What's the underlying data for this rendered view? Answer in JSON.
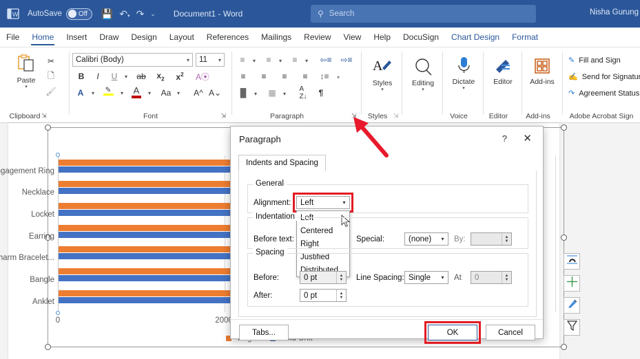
{
  "titlebar": {
    "app_icon": "word-logo-icon",
    "autosave_label": "AutoSave",
    "autosave_state": "Off",
    "save_icon": "save-icon",
    "undo_icon": "undo-icon",
    "redo_icon": "redo-icon",
    "more_icon": "more-commands-icon",
    "doc_title": "Document1  -  Word",
    "search_placeholder": "Search",
    "search_icon": "search-icon",
    "username": "Nisha Gurung"
  },
  "tabs": [
    {
      "label": "File",
      "active": false,
      "contextual": false
    },
    {
      "label": "Home",
      "active": true,
      "contextual": false
    },
    {
      "label": "Insert",
      "active": false,
      "contextual": false
    },
    {
      "label": "Draw",
      "active": false,
      "contextual": false
    },
    {
      "label": "Design",
      "active": false,
      "contextual": false
    },
    {
      "label": "Layout",
      "active": false,
      "contextual": false
    },
    {
      "label": "References",
      "active": false,
      "contextual": false
    },
    {
      "label": "Mailings",
      "active": false,
      "contextual": false
    },
    {
      "label": "Review",
      "active": false,
      "contextual": false
    },
    {
      "label": "View",
      "active": false,
      "contextual": false
    },
    {
      "label": "Help",
      "active": false,
      "contextual": false
    },
    {
      "label": "DocuSign",
      "active": false,
      "contextual": false
    },
    {
      "label": "Chart Design",
      "active": false,
      "contextual": true
    },
    {
      "label": "Format",
      "active": false,
      "contextual": true
    }
  ],
  "ribbon": {
    "clipboard": {
      "label": "Clipboard",
      "paste_label": "Paste",
      "paste_icon": "paste-icon",
      "cut_icon": "scissors-icon",
      "copy_icon": "copy-icon",
      "format_painter_icon": "format-painter-icon",
      "launcher_icon": "dialog-launcher-icon"
    },
    "font": {
      "label": "Font",
      "font_name": "Calibri (Body)",
      "font_size": "11",
      "bold_icon": "bold-icon",
      "italic_icon": "italic-icon",
      "underline_icon": "underline-icon",
      "strikethrough_icon": "strikethrough-icon",
      "subscript_icon": "subscript-icon",
      "superscript_icon": "superscript-icon",
      "clear_formatting_icon": "clear-formatting-icon",
      "text_effects_icon": "text-effects-icon",
      "highlight_icon": "text-highlight-icon",
      "font_color_icon": "font-color-icon",
      "change_case_icon": "change-case-icon",
      "grow_font_icon": "grow-font-icon",
      "shrink_font_icon": "shrink-font-icon",
      "launcher_icon": "dialog-launcher-icon"
    },
    "paragraph": {
      "label": "Paragraph",
      "bullets_icon": "bullets-icon",
      "numbering_icon": "numbering-icon",
      "multilevel_icon": "multilevel-list-icon",
      "decrease_indent_icon": "decrease-indent-icon",
      "increase_indent_icon": "increase-indent-icon",
      "align_left_icon": "align-left-icon",
      "align_center_icon": "align-center-icon",
      "align_right_icon": "align-right-icon",
      "justify_icon": "justify-icon",
      "line_spacing_icon": "line-spacing-icon",
      "shading_icon": "shading-icon",
      "borders_icon": "borders-icon",
      "sort_icon": "sort-icon",
      "show_marks_icon": "show-formatting-marks-icon",
      "launcher_icon": "dialog-launcher-icon"
    },
    "styles": {
      "label": "Styles",
      "button_label": "Styles",
      "icon": "styles-icon",
      "launcher_icon": "dialog-launcher-icon"
    },
    "editing": {
      "button_label": "Editing",
      "icon": "editing-search-icon"
    },
    "voice": {
      "label": "Voice",
      "button_label": "Dictate",
      "icon": "microphone-icon"
    },
    "editor": {
      "label": "Editor",
      "button_label": "Editor",
      "icon": "editor-pen-icon"
    },
    "addins": {
      "label": "Add-ins",
      "button_label": "Add-ins",
      "icon": "add-ins-grid-icon"
    },
    "adobe": {
      "label": "Adobe Acrobat Sign",
      "items": [
        {
          "label": "Fill and Sign",
          "icon": "fill-and-sign-icon"
        },
        {
          "label": "Send for Signature",
          "icon": "send-for-signature-icon"
        },
        {
          "label": "Agreement Status",
          "icon": "agreement-status-icon"
        }
      ]
    }
  },
  "chart_data": {
    "type": "bar",
    "orientation": "horizontal",
    "title": "",
    "categories": [
      "Ring Engagement Ring",
      "Necklace",
      "Locket",
      "Earring",
      "Charm Bracelet...",
      "Bangle",
      "Anklet"
    ],
    "series": [
      {
        "name": "Target",
        "color": "#ed7d31",
        "values": [
          2700,
          2620,
          2500,
          2680,
          2740,
          2700,
          2720
        ]
      },
      {
        "name": "Sold Unit",
        "color": "#4472c4",
        "values": [
          2660,
          2640,
          2700,
          2600,
          2730,
          2620,
          2680
        ]
      }
    ],
    "xlabel": "",
    "ylabel": "",
    "xticks": [
      "0",
      "2000"
    ],
    "xlim": [
      0,
      3000
    ],
    "grid": true,
    "legend_position": "bottom",
    "legend": [
      {
        "label": "Target",
        "color": "#ed7d31"
      },
      {
        "label": "Sold Unit",
        "color": "#4472c4"
      }
    ]
  },
  "chart_side_buttons": [
    {
      "name": "layout-options-icon",
      "title": "Layout Options"
    },
    {
      "name": "chart-elements-icon",
      "title": "Chart Elements"
    },
    {
      "name": "chart-styles-icon",
      "title": "Chart Styles"
    },
    {
      "name": "chart-filters-icon",
      "title": "Chart Filters"
    }
  ],
  "dialog": {
    "title": "Paragraph",
    "help_icon": "help-question-icon",
    "close_icon": "close-icon",
    "tab_label": "Indents and Spacing",
    "general": {
      "caption": "General",
      "alignment_label": "Alignment:",
      "alignment_value": "Left",
      "alignment_options": [
        "Left",
        "Centered",
        "Right",
        "Justified",
        "Distributed"
      ]
    },
    "indentation": {
      "caption": "Indentation",
      "before_text_label": "Before text:",
      "special_label": "Special:",
      "special_value": "(none)",
      "by_label": "By:",
      "by_value": ""
    },
    "spacing": {
      "caption": "Spacing",
      "before_label": "Before:",
      "before_value": "0 pt",
      "after_label": "After:",
      "after_value": "0 pt",
      "line_spacing_label": "Line Spacing:",
      "line_spacing_value": "Single",
      "at_label": "At",
      "at_value": "0"
    },
    "buttons": {
      "tabs_label": "Tabs...",
      "ok_label": "OK",
      "cancel_label": "Cancel"
    }
  },
  "annotations": {
    "red_arrow_target": "paragraph-dialog-launcher",
    "highlight_color": "#e31b23"
  }
}
